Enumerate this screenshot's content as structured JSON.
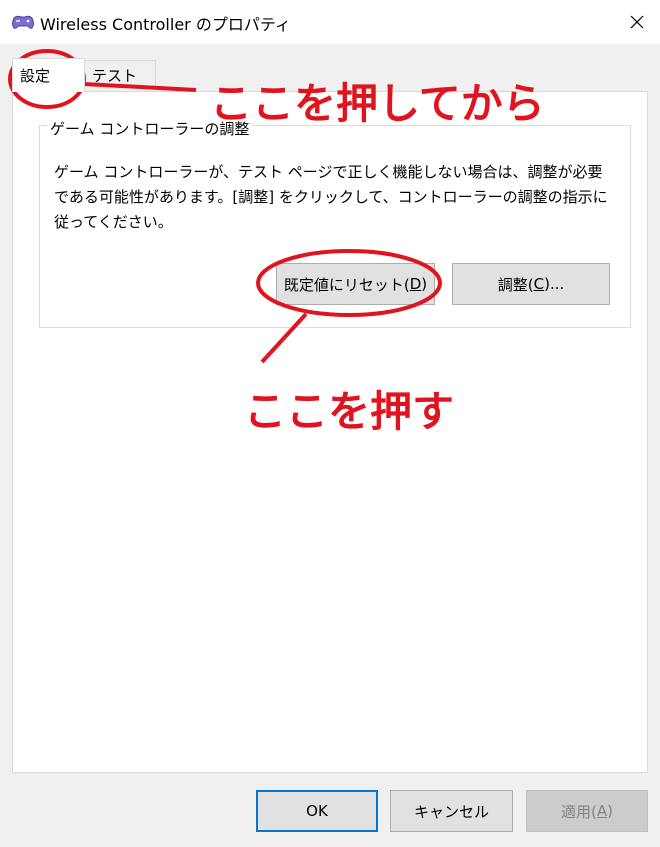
{
  "window": {
    "title": "Wireless Controller のプロパティ",
    "close_icon": "close-icon",
    "app_icon": "gamepad-icon"
  },
  "tabs": [
    {
      "label": "設定",
      "selected": true
    },
    {
      "label": "テスト",
      "selected": false
    }
  ],
  "group": {
    "title": "ゲーム コントローラーの調整",
    "description": "ゲーム コントローラーが、テスト ページで正しく機能しない場合は、調整が必要である可能性があります。[調整] をクリックして、コントローラーの調整の指示に従ってください。",
    "reset_button": {
      "text": "既定値にリセット(",
      "mnemonic": "D",
      "suffix": ")"
    },
    "calibrate_button": {
      "text": "調整(",
      "mnemonic": "C",
      "suffix": ")..."
    }
  },
  "footer": {
    "ok_label": "OK",
    "cancel_label": "キャンセル",
    "apply_button": {
      "text": "適用(",
      "mnemonic": "A",
      "suffix": ")",
      "disabled": true
    }
  },
  "annotations": {
    "step1": "ここを押してから",
    "step2": "ここを押す",
    "color": "#e0141e"
  }
}
